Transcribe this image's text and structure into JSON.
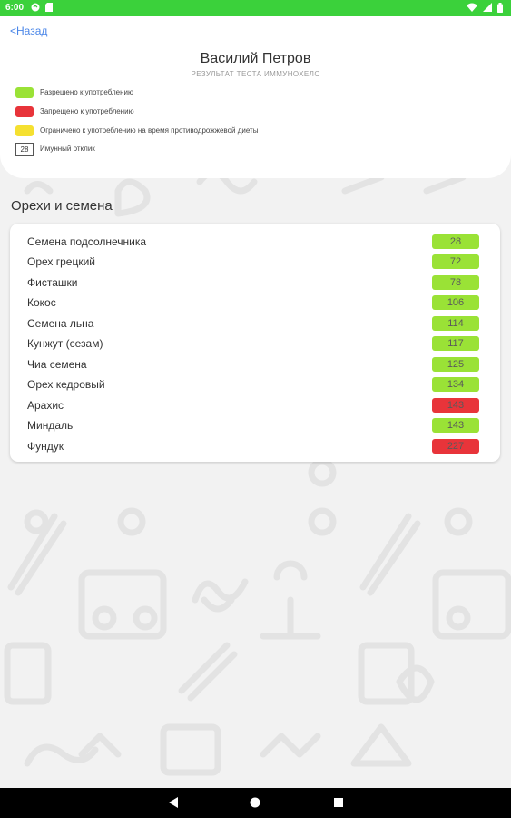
{
  "status_bar": {
    "time": "6:00"
  },
  "header": {
    "back_label": "<Назад",
    "user_name": "Василий Петров",
    "subtitle": "РЕЗУЛЬТАТ ТЕСТА ИММУНОХЕЛС"
  },
  "legend": {
    "allowed": {
      "label": "Разрешено к употреблению",
      "color": "#9ae236"
    },
    "forbidden": {
      "label": "Запрещено к употреблению",
      "color": "#e8343a"
    },
    "limited": {
      "label": "Ограничено к употреблению на время противодрожжевой диеты",
      "color": "#f5e030"
    },
    "immune": {
      "label": "Имунный отклик",
      "value": "28"
    }
  },
  "section": {
    "title": "Орехи и семена"
  },
  "items": [
    {
      "name": "Семена подсолнечника",
      "value": "28",
      "status": "allowed"
    },
    {
      "name": "Орех грецкий",
      "value": "72",
      "status": "allowed"
    },
    {
      "name": "Фисташки",
      "value": "78",
      "status": "allowed"
    },
    {
      "name": "Кокос",
      "value": "106",
      "status": "allowed"
    },
    {
      "name": "Семена льна",
      "value": "114",
      "status": "allowed"
    },
    {
      "name": "Кунжут (сезам)",
      "value": "117",
      "status": "allowed"
    },
    {
      "name": "Чиа семена",
      "value": "125",
      "status": "allowed"
    },
    {
      "name": "Орех кедровый",
      "value": "134",
      "status": "allowed"
    },
    {
      "name": "Арахис",
      "value": "143",
      "status": "forbidden"
    },
    {
      "name": "Миндаль",
      "value": "143",
      "status": "allowed"
    },
    {
      "name": "Фундук",
      "value": "227",
      "status": "forbidden"
    }
  ],
  "colors": {
    "status_bar": "#3bd13b",
    "link": "#4a86e8",
    "allowed": "#9ae236",
    "forbidden": "#e8343a",
    "limited": "#f5e030"
  },
  "nav": {
    "back_icon": "back-triangle-icon",
    "home_icon": "home-circle-icon",
    "recents_icon": "recents-square-icon"
  }
}
